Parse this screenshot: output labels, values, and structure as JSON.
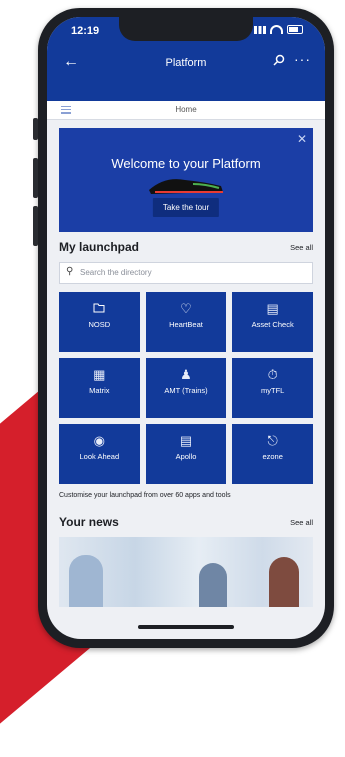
{
  "status": {
    "time": "12:19"
  },
  "nav": {
    "title": "Platform",
    "back_icon": "arrow-left-icon",
    "search_icon": "search-icon",
    "more_icon": "more-icon"
  },
  "subnav": {
    "label": "Home"
  },
  "banner": {
    "headline": "Welcome to your Platform",
    "cta": "Take the tour",
    "close": "✕"
  },
  "launchpad": {
    "title": "My launchpad",
    "see_all": "See all",
    "search_placeholder": "Search the directory",
    "tiles": [
      {
        "label": "NOSD",
        "icon": "folder-icon"
      },
      {
        "label": "HeartBeat",
        "icon": "heart-icon"
      },
      {
        "label": "Asset Check",
        "icon": "checklist-icon"
      },
      {
        "label": "Matrix",
        "icon": "calendar-grid-icon"
      },
      {
        "label": "AMT (Trains)",
        "icon": "people-icon"
      },
      {
        "label": "myTFL",
        "icon": "stopwatch-icon"
      },
      {
        "label": "Look Ahead",
        "icon": "look-ahead-icon"
      },
      {
        "label": "Apollo",
        "icon": "document-icon"
      },
      {
        "label": "ezone",
        "icon": "car-icon"
      }
    ],
    "customize_text": "Customise your launchpad from over 60 apps and tools"
  },
  "news": {
    "title": "Your news",
    "see_all": "See all"
  },
  "colors": {
    "brand_blue": "#123a9a",
    "accent_red": "#d51f2b",
    "phone_frame": "#1d1f24"
  }
}
